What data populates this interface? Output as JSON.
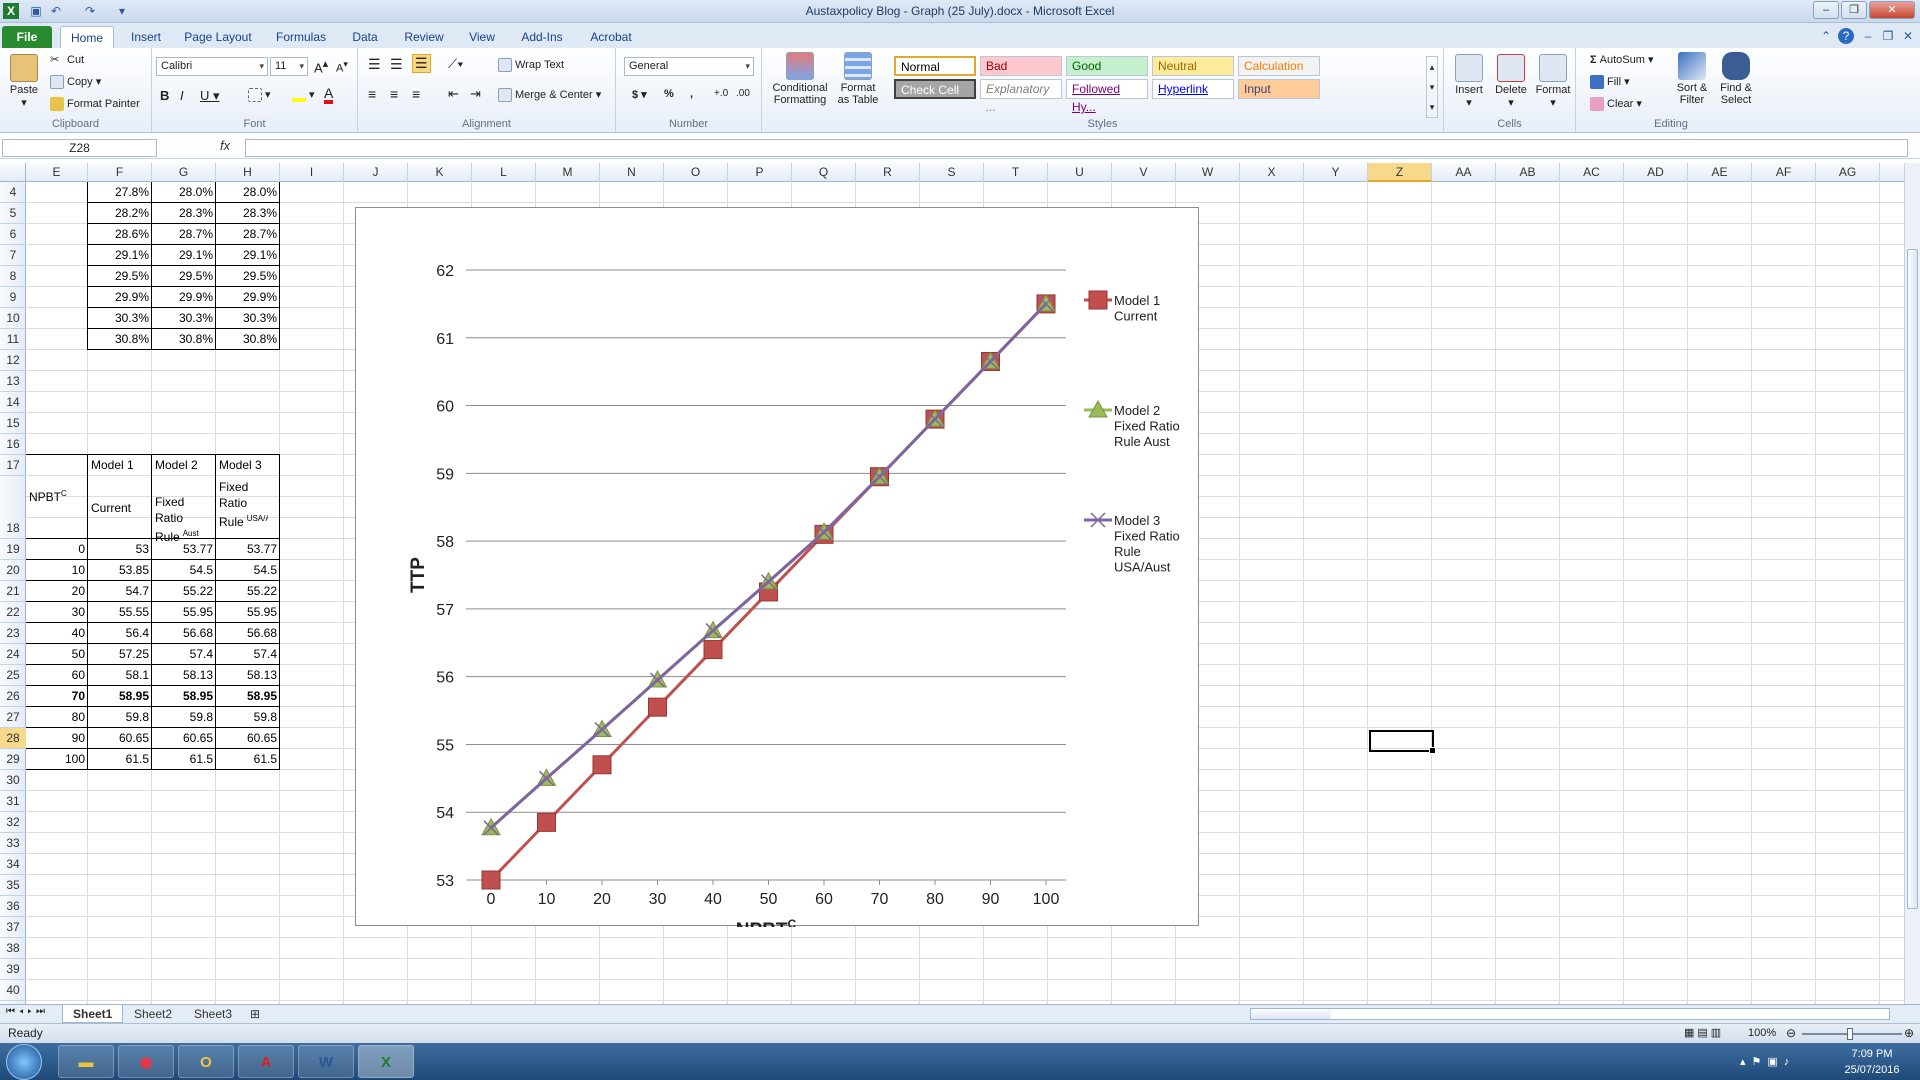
{
  "window": {
    "title": "Austaxpolicy Blog - Graph (25 July).docx - Microsoft Excel"
  },
  "tabs": [
    "File",
    "Home",
    "Insert",
    "Page Layout",
    "Formulas",
    "Data",
    "Review",
    "View",
    "Add-Ins",
    "Acrobat"
  ],
  "ribbon": {
    "clipboard": {
      "paste": "Paste",
      "cut": "Cut",
      "copy": "Copy",
      "format_painter": "Format Painter",
      "label": "Clipboard"
    },
    "font": {
      "name": "Calibri",
      "size": "11",
      "label": "Font"
    },
    "alignment": {
      "wrap_text": "Wrap Text",
      "merge_center": "Merge & Center",
      "label": "Alignment"
    },
    "number": {
      "format": "General",
      "currency": "$",
      "percent": "%",
      "comma": ",",
      "label": "Number"
    },
    "styles": {
      "conditional": "Conditional Formatting",
      "format_table": "Format as Table",
      "cells": [
        {
          "label": "Normal",
          "bg": "#ffffff",
          "fg": "#000000"
        },
        {
          "label": "Bad",
          "bg": "#ffc7ce",
          "fg": "#9c0006"
        },
        {
          "label": "Good",
          "bg": "#c6efce",
          "fg": "#006100"
        },
        {
          "label": "Neutral",
          "bg": "#ffeb9c",
          "fg": "#9c6500"
        },
        {
          "label": "Calculation",
          "bg": "#f2f2f2",
          "fg": "#fa7d00"
        },
        {
          "label": "Check Cell",
          "bg": "#a5a5a5",
          "fg": "#ffffff"
        },
        {
          "label": "Explanatory ...",
          "bg": "#ffffff",
          "fg": "#7f7f7f"
        },
        {
          "label": "Followed Hy...",
          "bg": "#ffffff",
          "fg": "#800080"
        },
        {
          "label": "Hyperlink",
          "bg": "#ffffff",
          "fg": "#0000ff"
        },
        {
          "label": "Input",
          "bg": "#ffcc99",
          "fg": "#3f3f76"
        }
      ],
      "label": "Styles"
    },
    "cells": {
      "insert": "Insert",
      "delete": "Delete",
      "format": "Format",
      "label": "Cells"
    },
    "editing": {
      "autosum": "AutoSum",
      "fill": "Fill",
      "clear": "Clear",
      "sort": "Sort & Filter",
      "find": "Find & Select",
      "label": "Editing"
    }
  },
  "formula_bar": {
    "name_box": "Z28",
    "fx": "fx",
    "value": ""
  },
  "columns": [
    "E",
    "F",
    "G",
    "H",
    "I",
    "J",
    "K",
    "L",
    "M",
    "N",
    "O",
    "P",
    "Q",
    "R",
    "S",
    "T",
    "U",
    "V",
    "W",
    "X",
    "Y",
    "Z",
    "AA",
    "AB",
    "AC",
    "AD",
    "AE",
    "AF",
    "AG"
  ],
  "rows": [
    "4",
    "5",
    "6",
    "7",
    "8",
    "9",
    "10",
    "11",
    "12",
    "13",
    "14",
    "15",
    "16",
    "17",
    "18",
    "19",
    "20",
    "21",
    "22",
    "23",
    "24",
    "25",
    "26",
    "27",
    "28",
    "29",
    "30",
    "31",
    "32",
    "33",
    "34",
    "35",
    "36",
    "37",
    "38",
    "39",
    "40"
  ],
  "selected": {
    "column": "Z",
    "row": "28"
  },
  "pct_table": [
    [
      "27.8%",
      "28.0%",
      "28.0%"
    ],
    [
      "28.2%",
      "28.3%",
      "28.3%"
    ],
    [
      "28.6%",
      "28.7%",
      "28.7%"
    ],
    [
      "29.1%",
      "29.1%",
      "29.1%"
    ],
    [
      "29.5%",
      "29.5%",
      "29.5%"
    ],
    [
      "29.9%",
      "29.9%",
      "29.9%"
    ],
    [
      "30.3%",
      "30.3%",
      "30.3%"
    ],
    [
      "30.8%",
      "30.8%",
      "30.8%"
    ]
  ],
  "data_table": {
    "npbt_label": "NPBT",
    "npbt_sup": "C",
    "h1": {
      "title": "Model 1",
      "sub": "Current"
    },
    "h2": {
      "title": "Model 2",
      "sub": "Fixed Ratio Rule",
      "sup": "Aust"
    },
    "h3": {
      "title": "Model 3",
      "sub": "Fixed Ratio Rule",
      "sup": "USA/Aust"
    },
    "rows": [
      [
        "0",
        "53",
        "53.77",
        "53.77"
      ],
      [
        "10",
        "53.85",
        "54.5",
        "54.5"
      ],
      [
        "20",
        "54.7",
        "55.22",
        "55.22"
      ],
      [
        "30",
        "55.55",
        "55.95",
        "55.95"
      ],
      [
        "40",
        "56.4",
        "56.68",
        "56.68"
      ],
      [
        "50",
        "57.25",
        "57.4",
        "57.4"
      ],
      [
        "60",
        "58.1",
        "58.13",
        "58.13"
      ],
      [
        "70",
        "58.95",
        "58.95",
        "58.95"
      ],
      [
        "80",
        "59.8",
        "59.8",
        "59.8"
      ],
      [
        "90",
        "60.65",
        "60.65",
        "60.65"
      ],
      [
        "100",
        "61.5",
        "61.5",
        "61.5"
      ]
    ]
  },
  "chart_data": {
    "type": "line",
    "x": [
      0,
      10,
      20,
      30,
      40,
      50,
      60,
      70,
      80,
      90,
      100
    ],
    "xlabel": "NPBT",
    "xlabel_sup": "C",
    "ylabel": "TTP",
    "ylim": [
      53,
      62
    ],
    "yticks": [
      53,
      54,
      55,
      56,
      57,
      58,
      59,
      60,
      61,
      62
    ],
    "grid": true,
    "legend": "right",
    "series": [
      {
        "name": "Model 1 Current",
        "legend_lines": [
          "Model 1",
          "Current"
        ],
        "color": "#c0504d",
        "marker": "square",
        "values": [
          53,
          53.85,
          54.7,
          55.55,
          56.4,
          57.25,
          58.1,
          58.95,
          59.8,
          60.65,
          61.5
        ]
      },
      {
        "name": "Model 2 Fixed Ratio Rule Aust",
        "legend_lines": [
          "Model 2",
          "Fixed Ratio",
          "Rule Aust"
        ],
        "color": "#9bbb59",
        "marker": "triangle",
        "values": [
          53.77,
          54.5,
          55.22,
          55.95,
          56.68,
          57.4,
          58.13,
          58.95,
          59.8,
          60.65,
          61.5
        ]
      },
      {
        "name": "Model 3 Fixed Ratio Rule USA/Aust",
        "legend_lines": [
          "Model 3",
          "Fixed Ratio",
          "Rule",
          "USA/Aust"
        ],
        "color": "#8064a2",
        "marker": "x",
        "values": [
          53.77,
          54.5,
          55.22,
          55.95,
          56.68,
          57.4,
          58.13,
          58.95,
          59.8,
          60.65,
          61.5
        ]
      }
    ]
  },
  "sheets": [
    "Sheet1",
    "Sheet2",
    "Sheet3"
  ],
  "status": {
    "ready": "Ready",
    "zoom": "100%"
  },
  "taskbar": {
    "time": "7:09 PM",
    "date": "25/07/2016"
  }
}
